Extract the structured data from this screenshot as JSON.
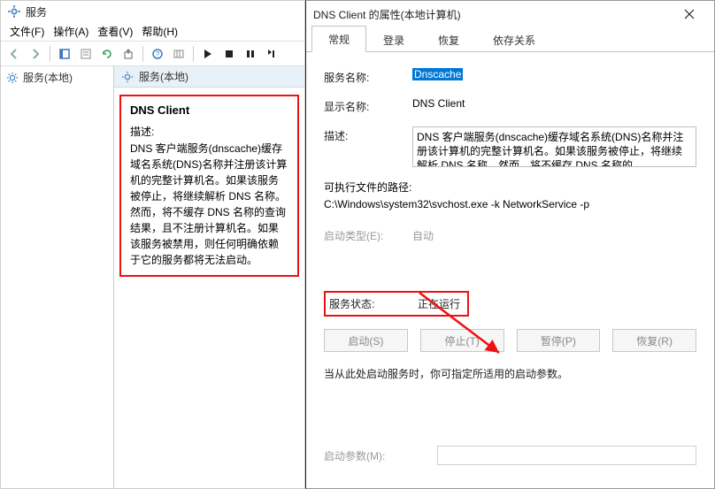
{
  "services_window": {
    "title": "服务",
    "menubar": {
      "file": "文件(F)",
      "action": "操作(A)",
      "view": "查看(V)",
      "help": "帮助(H)"
    },
    "toolbar_icons": [
      "back",
      "forward",
      "up",
      "list",
      "prop",
      "refresh",
      "export",
      "help",
      "col",
      "start",
      "stop",
      "pause",
      "restart"
    ],
    "left_pane_item": "服务(本地)",
    "detail_header": "服务(本地)",
    "detail_title": "DNS Client",
    "detail_desc_label": "描述:",
    "detail_desc": "DNS 客户端服务(dnscache)缓存域名系统(DNS)名称并注册该计算机的完整计算机名。如果该服务被停止，将继续解析 DNS 名称。然而，将不缓存 DNS 名称的查询结果，且不注册计算机名。如果该服务被禁用，则任何明确依赖于它的服务都将无法启动。"
  },
  "props_dialog": {
    "title": "DNS Client 的属性(本地计算机)",
    "tabs": {
      "general": "常规",
      "logon": "登录",
      "recovery": "恢复",
      "deps": "依存关系"
    },
    "rows": {
      "service_name_label": "服务名称:",
      "service_name_value": "Dnscache",
      "display_name_label": "显示名称:",
      "display_name_value": "DNS Client",
      "desc_label": "描述:",
      "desc_value": "DNS 客户端服务(dnscache)缓存域名系统(DNS)名称并注册该计算机的完整计算机名。如果该服务被停止，将继续解析 DNS 名称。然而，将不缓存 DNS 名称的",
      "exe_path_label": "可执行文件的路径:",
      "exe_path_value": "C:\\Windows\\system32\\svchost.exe -k NetworkService -p",
      "startup_label": "启动类型(E):",
      "startup_value": "自动",
      "status_label": "服务状态:",
      "status_value": "正在运行"
    },
    "buttons": {
      "start": "启动(S)",
      "stop": "停止(T)",
      "pause": "暂停(P)",
      "resume": "恢复(R)"
    },
    "hint": "当从此处启动服务时，你可指定所适用的启动参数。",
    "param_label": "启动参数(M):",
    "param_value": ""
  }
}
